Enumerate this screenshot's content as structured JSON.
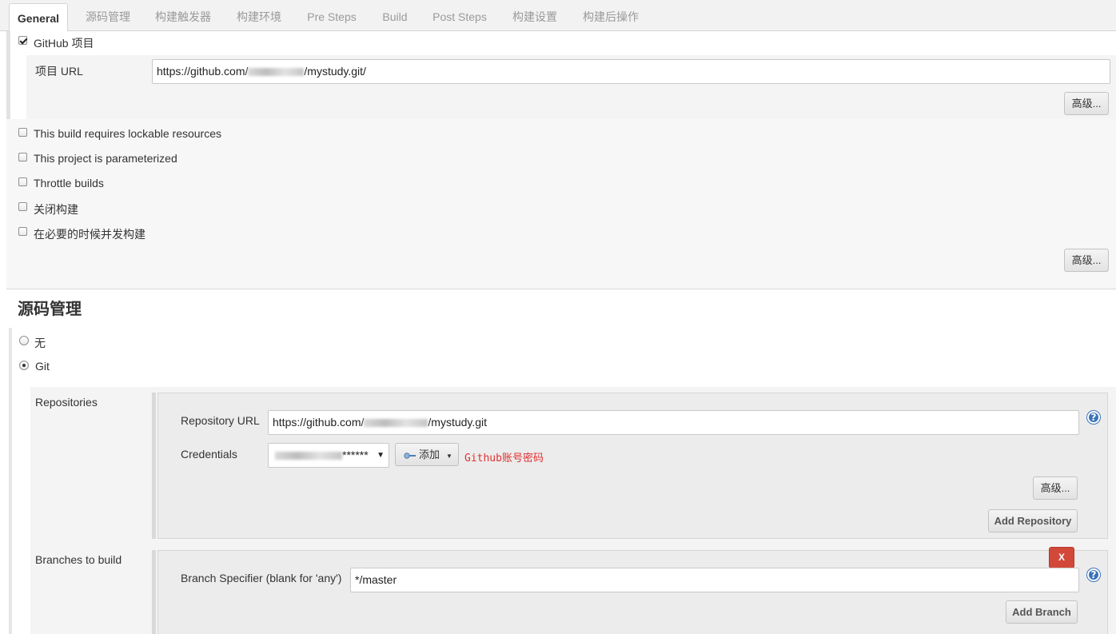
{
  "tabs": [
    "General",
    "源码管理",
    "构建触发器",
    "构建环境",
    "Pre Steps",
    "Build",
    "Post Steps",
    "构建设置",
    "构建后操作"
  ],
  "active_tab": "General",
  "general": {
    "github_project_label": "GitHub 项目",
    "github_project_checked": true,
    "project_url_label": "项目 URL",
    "project_url_prefix": "https://github.com/",
    "project_url_suffix": "/mystudy.git/",
    "advanced_label": "高级...",
    "options": [
      {
        "label": "This build requires lockable resources",
        "checked": false
      },
      {
        "label": "This project is parameterized",
        "checked": false
      },
      {
        "label": "Throttle builds",
        "checked": false
      },
      {
        "label": "关闭构建",
        "checked": false
      },
      {
        "label": "在必要的时候并发构建",
        "checked": false
      }
    ],
    "advanced_label_2": "高级..."
  },
  "scm": {
    "title": "源码管理",
    "radio_none": "无",
    "radio_git": "Git",
    "selected": "Git",
    "repositories_label": "Repositories",
    "repo_url_label": "Repository URL",
    "repo_url_prefix": "https://github.com/",
    "repo_url_suffix": "/mystudy.git",
    "credentials_label": "Credentials",
    "credentials_value_suffix": "******",
    "add_button": "添加",
    "annotation": "Github账号密码",
    "annotation_color": "#e03030",
    "advanced_label": "高级...",
    "add_repository": "Add Repository",
    "branches_label": "Branches to build",
    "delete_button": "X",
    "delete_color": "#d24939",
    "branch_spec_label": "Branch Specifier (blank for 'any')",
    "branch_spec_value": "*/master",
    "add_branch": "Add Branch"
  }
}
